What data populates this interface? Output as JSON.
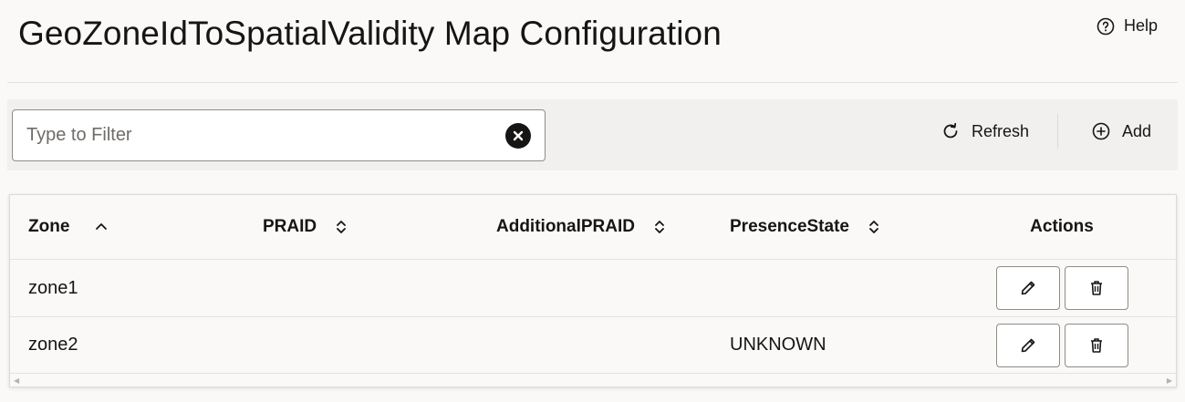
{
  "header": {
    "title": "GeoZoneIdToSpatialValidity Map Configuration",
    "help_label": "Help"
  },
  "toolbar": {
    "filter_placeholder": "Type to Filter",
    "filter_value": "",
    "refresh_label": "Refresh",
    "add_label": "Add"
  },
  "table": {
    "columns": [
      "Zone",
      "PRAID",
      "AdditionalPRAID",
      "PresenceState",
      "Actions"
    ],
    "sort": {
      "column": "Zone",
      "direction": "ascending"
    },
    "rows": [
      {
        "zone": "zone1",
        "praid": "",
        "additional_praid": "",
        "presence_state": ""
      },
      {
        "zone": "zone2",
        "praid": "",
        "additional_praid": "",
        "presence_state": "UNKNOWN"
      }
    ]
  },
  "icons": {
    "help": "help-circle-icon",
    "clear": "clear-icon",
    "refresh": "refresh-icon",
    "add": "add-circle-icon",
    "sort_asc": "sort-ascending-icon",
    "sort_unsorted": "sort-unsorted-icon",
    "edit": "pencil-icon",
    "delete": "trash-icon"
  }
}
